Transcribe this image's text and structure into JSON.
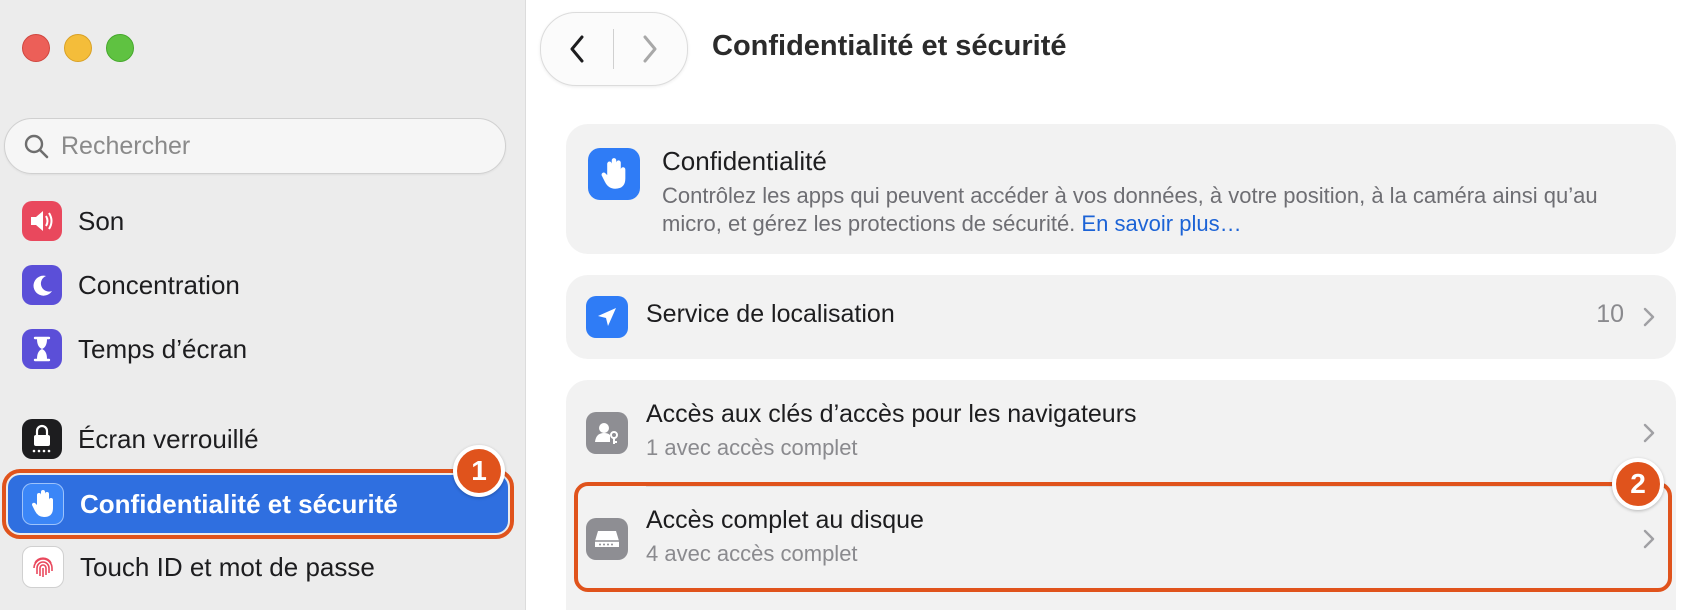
{
  "window": {
    "title": "Confidentialité et sécurité"
  },
  "search": {
    "placeholder": "Rechercher"
  },
  "sidebar": {
    "items": [
      {
        "label": "Son",
        "icon": "speaker-icon",
        "color": "#e9485d"
      },
      {
        "label": "Concentration",
        "icon": "moon-icon",
        "color": "#5b4fd8"
      },
      {
        "label": "Temps d’écran",
        "icon": "hourglass-icon",
        "color": "#5b4fd8"
      },
      {
        "label": "Écran verrouillé",
        "icon": "lock-icon",
        "color": "#1d1d1f"
      },
      {
        "label": "Confidentialité et sécurité",
        "icon": "hand-icon",
        "color": "#2f7cf6",
        "selected": true
      },
      {
        "label": "Touch ID et mot de passe",
        "icon": "fingerprint-icon",
        "color": "#ffffff"
      }
    ]
  },
  "annotations": {
    "badge1": "1",
    "badge2": "2",
    "color": "#e0531c"
  },
  "intro": {
    "title": "Confidentialité",
    "description": "Contrôlez les apps qui peuvent accéder à vos données, à votre position, à la caméra ainsi qu’au micro, et gérez les protections de sécurité.",
    "link": "En savoir plus…"
  },
  "location": {
    "label": "Service de localisation",
    "value": "10"
  },
  "access": {
    "rows": [
      {
        "label": "Accès aux clés d’accès pour les navigateurs",
        "sub": "1 avec accès complet"
      },
      {
        "label": "Accès complet au disque",
        "sub": "4 avec accès complet"
      }
    ]
  }
}
